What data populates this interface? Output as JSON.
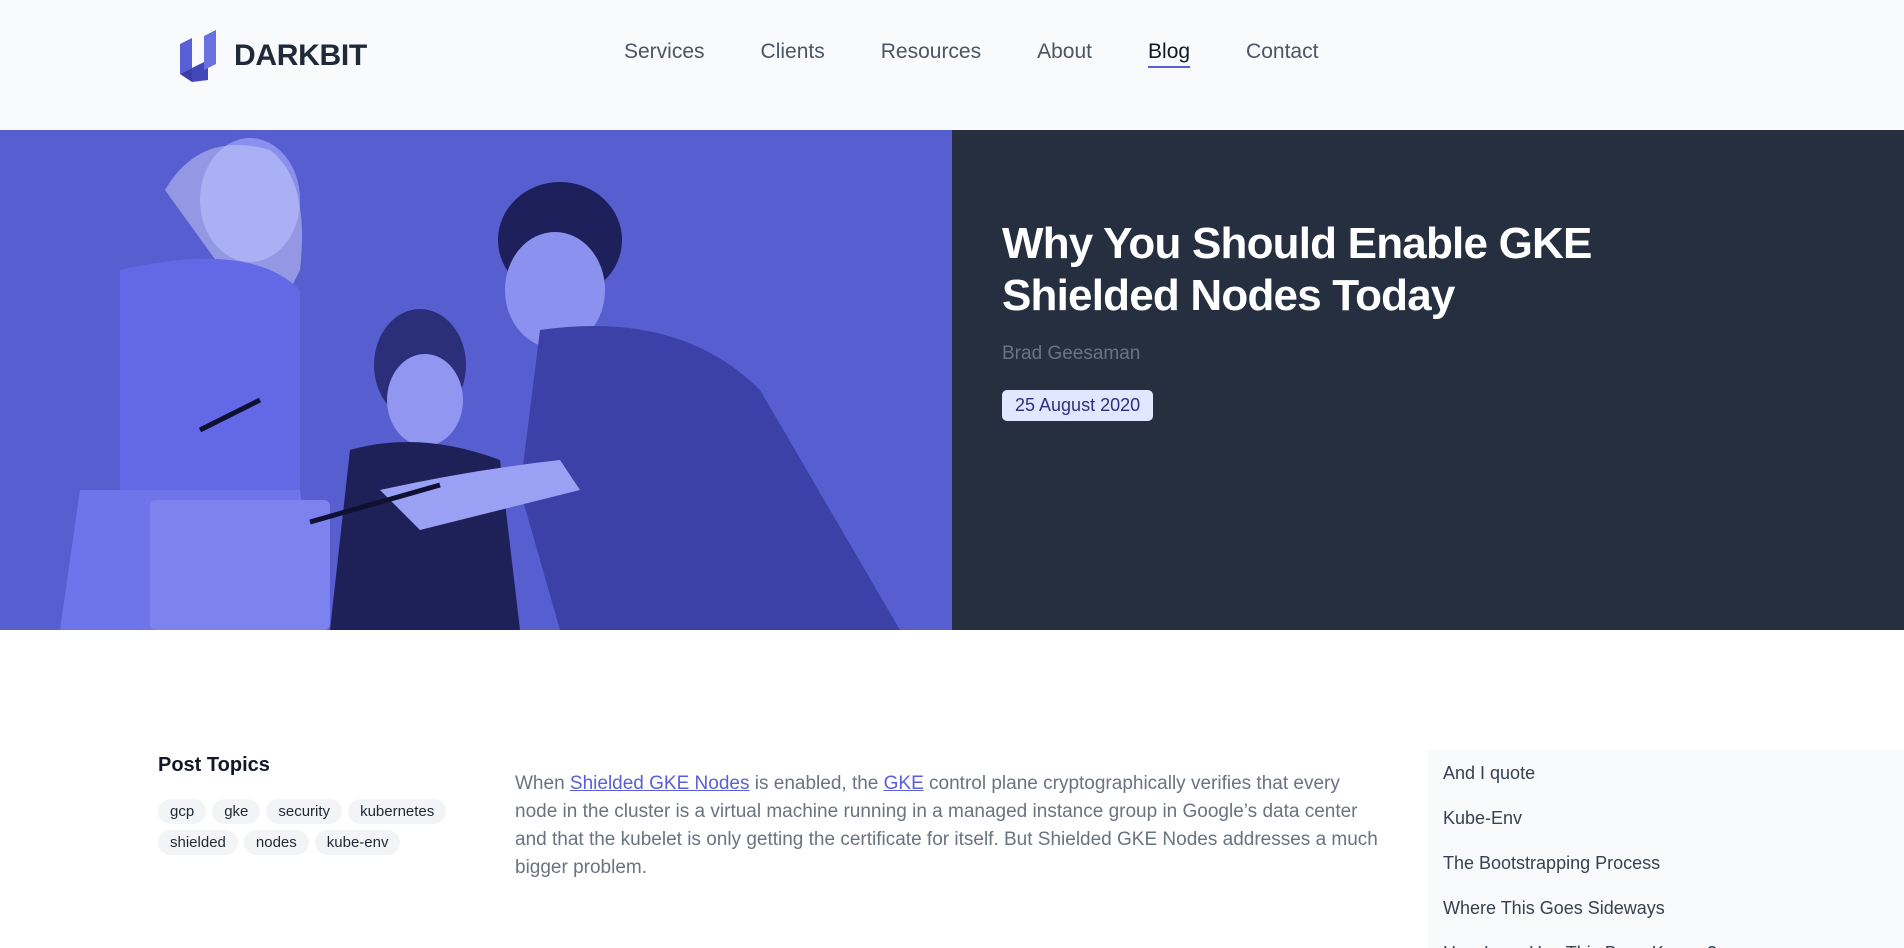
{
  "brand": {
    "name": "DARKBIT",
    "logo_icon": "darkbit-logo-icon"
  },
  "nav": {
    "items": [
      {
        "label": "Services",
        "active": false
      },
      {
        "label": "Clients",
        "active": false
      },
      {
        "label": "Resources",
        "active": false
      },
      {
        "label": "About",
        "active": false
      },
      {
        "label": "Blog",
        "active": true
      },
      {
        "label": "Contact",
        "active": false
      }
    ]
  },
  "hero": {
    "title": "Why You Should Enable GKE Shielded Nodes Today",
    "author": "Brad Geesaman",
    "date": "25 August 2020",
    "image_color": "#575ecf",
    "panel_color": "#252f3f"
  },
  "topics": {
    "title": "Post Topics",
    "tags": [
      "gcp",
      "gke",
      "security",
      "kubernetes",
      "shielded",
      "nodes",
      "kube-env"
    ]
  },
  "article": {
    "p1_before": "When ",
    "link1": "Shielded GKE Nodes",
    "p1_mid": " is enabled, the ",
    "link2": "GKE",
    "p1_after": " control plane cryptographically verifies that every node in the cluster is a virtual machine running in a managed instance group in Google’s data center and that the kubelet is only getting the certificate for itself. But Shielded GKE Nodes addresses a much bigger problem."
  },
  "toc": {
    "items": [
      "And I quote",
      "Kube-Env",
      "The Bootstrapping Process",
      "Where This Goes Sideways",
      "How Long Has This Been Known?"
    ]
  },
  "colors": {
    "accent": "#5a5fd6",
    "date_badge_bg": "#e0e7ff"
  }
}
